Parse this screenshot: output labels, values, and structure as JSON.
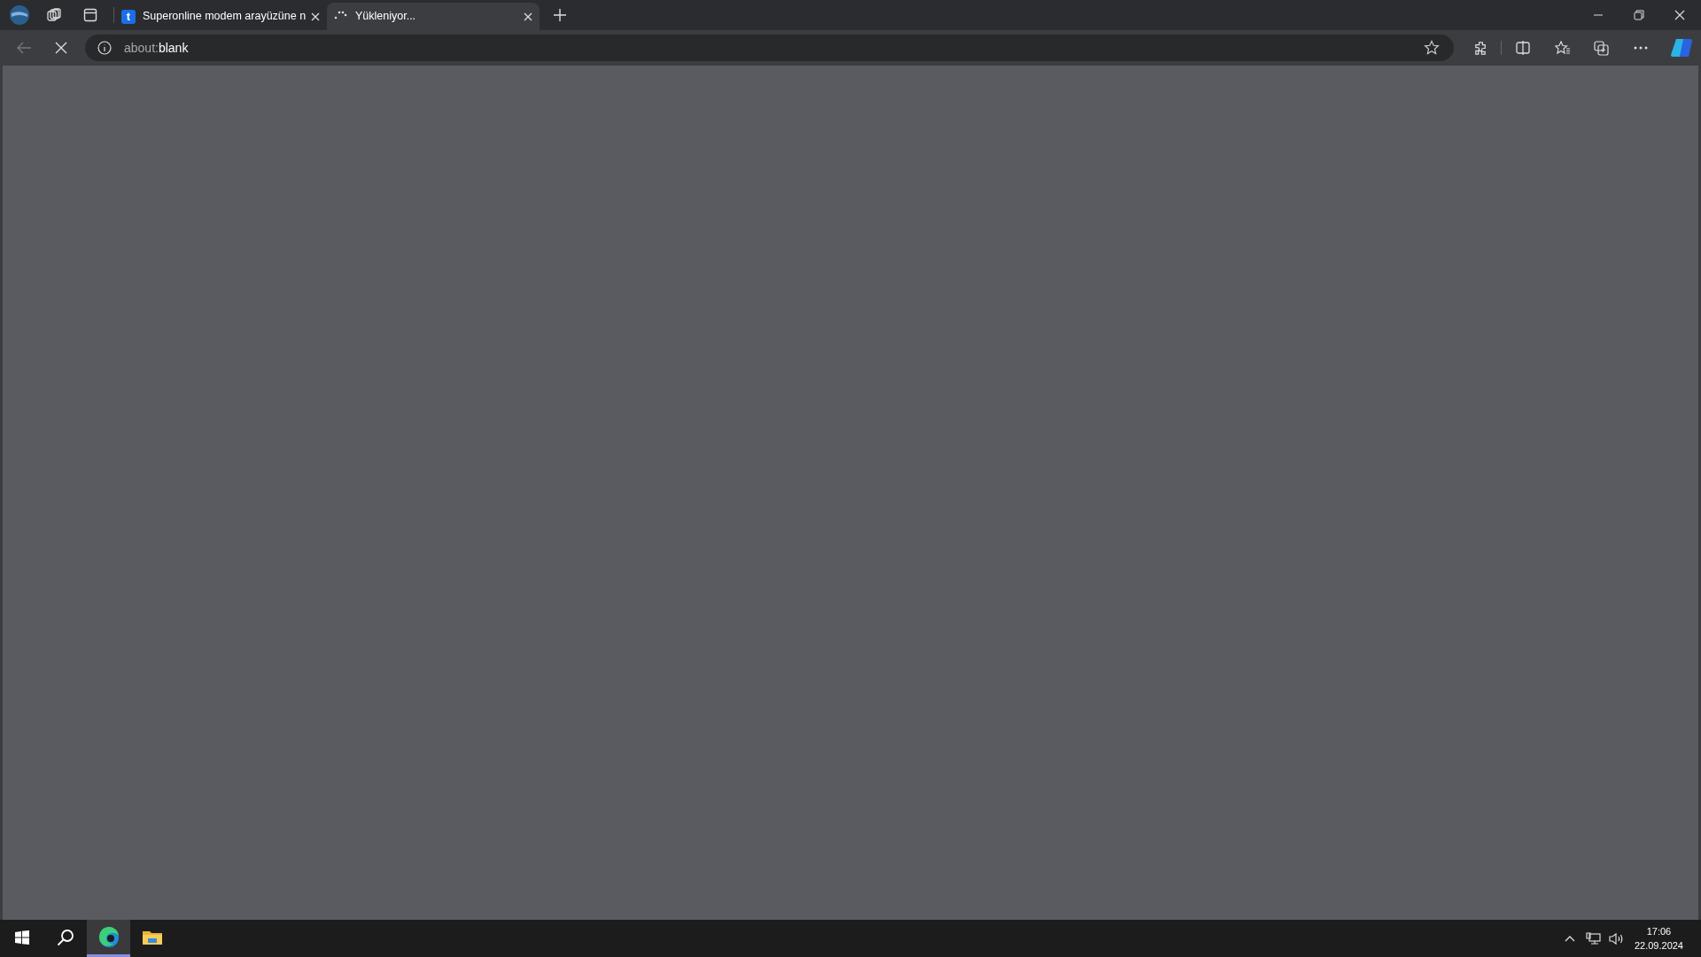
{
  "tabs": [
    {
      "kind": "favicon",
      "favicon_letter": "t",
      "label": "Superonline modem arayüzüne n",
      "selected": false
    },
    {
      "kind": "loading",
      "label": "Yükleniyor...",
      "selected": true
    }
  ],
  "toolbar": {
    "back_disabled": true,
    "loading": true
  },
  "address": {
    "scheme": "about:",
    "path": "blank"
  },
  "taskbar": {
    "apps": [
      {
        "kind": "start",
        "selected": false
      },
      {
        "kind": "search",
        "selected": false
      },
      {
        "kind": "browser",
        "selected": true
      },
      {
        "kind": "folder",
        "selected": false
      }
    ],
    "time": "17:06",
    "date": "22.09.2024"
  }
}
